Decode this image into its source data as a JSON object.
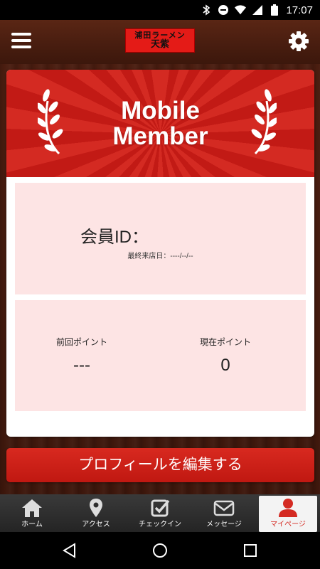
{
  "status_bar": {
    "time": "17:07",
    "icons": [
      "bluetooth-icon",
      "dnd-icon",
      "wifi-icon",
      "signal-icon",
      "battery-icon"
    ]
  },
  "header": {
    "logo_line1": "浦田ラーメン",
    "logo_line2": "天紫",
    "menu_icon": "hamburger-menu-icon",
    "settings_icon": "gear-icon"
  },
  "card": {
    "banner_title": "Mobile Member",
    "member_id_label": "会員ID：",
    "member_id_value": "",
    "last_visit_label": "最終来店日：",
    "last_visit_value": "----/--/--",
    "previous_points_label": "前回ポイント",
    "previous_points_value": "---",
    "current_points_label": "現在ポイント",
    "current_points_value": "0"
  },
  "edit_profile_button": "プロフィールを編集する",
  "tabs": [
    {
      "label": "ホーム",
      "icon": "home-icon"
    },
    {
      "label": "アクセス",
      "icon": "map-pin-icon"
    },
    {
      "label": "チェックイン",
      "icon": "checkbox-icon"
    },
    {
      "label": "メッセージ",
      "icon": "envelope-icon"
    },
    {
      "label": "マイページ",
      "icon": "user-icon",
      "active": true
    }
  ],
  "nav_bar": {
    "back": "back-triangle-icon",
    "home": "home-circle-icon",
    "recents": "recents-square-icon"
  },
  "colors": {
    "accent_red": "#d42a22",
    "panel_pink": "#fde4e4",
    "wood_brown": "#4a1d10",
    "tab_bar": "#2e2e2e"
  }
}
